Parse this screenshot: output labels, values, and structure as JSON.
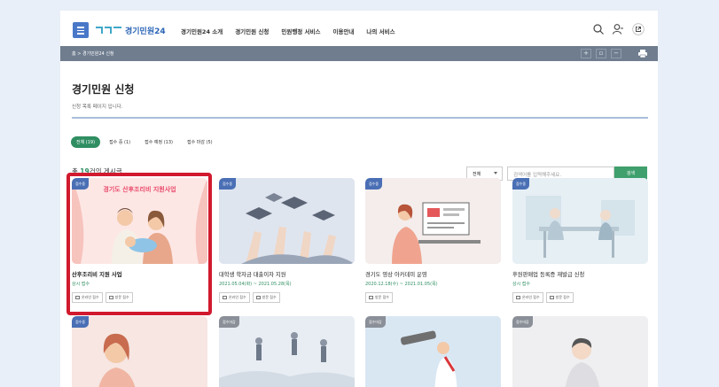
{
  "header": {
    "logo_text": "경기민원24",
    "nav": [
      "경기민원24 소개",
      "경기민원 신청",
      "민원행정 서비스",
      "이용안내",
      "나의 서비스"
    ]
  },
  "breadcrumb": "홈 > 경기민원24 신청",
  "page": {
    "title": "경기민원 신청",
    "description": "신청 목록 페이지 입니다."
  },
  "tabs": [
    "전체 (19)",
    "접수 중 (1)",
    "접수 예정 (13)",
    "접수 마감 (5)"
  ],
  "total": {
    "prefix": "총 ",
    "count": "19",
    "suffix": "건의 게시글"
  },
  "search": {
    "select_value": "전체",
    "placeholder": "검색어를 입력해주세요.",
    "button": "검색"
  },
  "cards": [
    {
      "badge": "접수중",
      "title": "산후조리비 지원 사업",
      "status": "상시 접수",
      "chips": [
        "온라인 접수",
        "방문 접수"
      ],
      "banner": "경기도 산후조리비 지원사업"
    },
    {
      "badge": "접수중",
      "title": "대학생 학자금 대출이자 지원",
      "status": "2021.05.04(화) ~ 2021.05.28(목)",
      "chips": [
        "온라인 접수",
        "방문 접수"
      ]
    },
    {
      "badge": "접수중",
      "title": "경기도 영상 아카데미 운영",
      "status": "2020.12.18(수) ~ 2021.01.05(목)",
      "chips": [
        "방문 접수"
      ]
    },
    {
      "badge": "접수중",
      "title": "후원판매업 등록증 재발급 신청",
      "status": "상시 접수",
      "chips": [
        "온라인 접수",
        "방문 접수"
      ]
    },
    {
      "badge": "접수중",
      "title": "",
      "status": "",
      "chips": []
    },
    {
      "badge": "접수마감",
      "title": "",
      "status": "",
      "chips": []
    },
    {
      "badge": "접수마감",
      "title": "",
      "status": "",
      "chips": []
    },
    {
      "badge": "접수마감",
      "title": "",
      "status": "",
      "chips": []
    }
  ],
  "colors": {
    "accent": "#2f8e62",
    "brand": "#2a64b5",
    "highlight": "#d11a2e",
    "bar": "#6f7d8f"
  }
}
